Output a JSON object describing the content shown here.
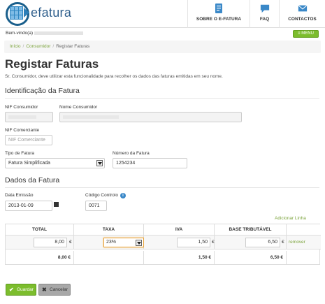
{
  "header": {
    "logo_text": "efatura",
    "nav": [
      {
        "label": "SOBRE O E-FATURA",
        "icon": "document-icon"
      },
      {
        "label": "FAQ",
        "icon": "chat-bubble-icon"
      },
      {
        "label": "CONTACTOS",
        "icon": "envelope-icon"
      }
    ]
  },
  "user_bar": {
    "welcome": "Bem-vindo(a)",
    "menu_label": "≡ MENU"
  },
  "breadcrumb": [
    "Início",
    "Consumidor",
    "Registar Faturas"
  ],
  "page": {
    "title": "Registar Faturas",
    "intro": "Sr. Consumidor, deve utilizar esta funcionalidade para recolher os dados das faturas emitidas em seu nome."
  },
  "identificacao": {
    "title": "Identificação da Fatura",
    "nif_consumidor_label": "NIF Consumidor",
    "nome_consumidor_label": "Nome Consumidor",
    "nif_comerciante_label": "NIF Comerciante",
    "nif_comerciante_placeholder": "NIF Comerciante",
    "tipo_label": "Tipo de Fatura",
    "tipo_value": "Fatura Simplificada",
    "numero_label": "Número da Fatura",
    "numero_value": "1254234"
  },
  "dados": {
    "title": "Dados da Fatura",
    "data_label": "Data Emissão",
    "data_value": "2013-01-09",
    "codigo_label": "Código Controlo",
    "codigo_value": "0071",
    "add_line": "Adicionar Linha"
  },
  "table": {
    "headers": [
      "TOTAL",
      "TAXA",
      "IVA",
      "BASE TRIBUTÁVEL"
    ],
    "row": {
      "total": "8,00",
      "taxa": "23%",
      "iva": "1,50",
      "base": "6,50",
      "remove": "remover"
    },
    "currency": "€",
    "footer": {
      "total": "8,00 €",
      "iva": "1,50 €",
      "base": "6,50 €"
    }
  },
  "actions": {
    "save": "Guardar",
    "cancel": "Cancelar"
  },
  "colors": {
    "accent": "#7cbd2d",
    "link": "#7ba33b",
    "brand": "#2f5f8c"
  }
}
